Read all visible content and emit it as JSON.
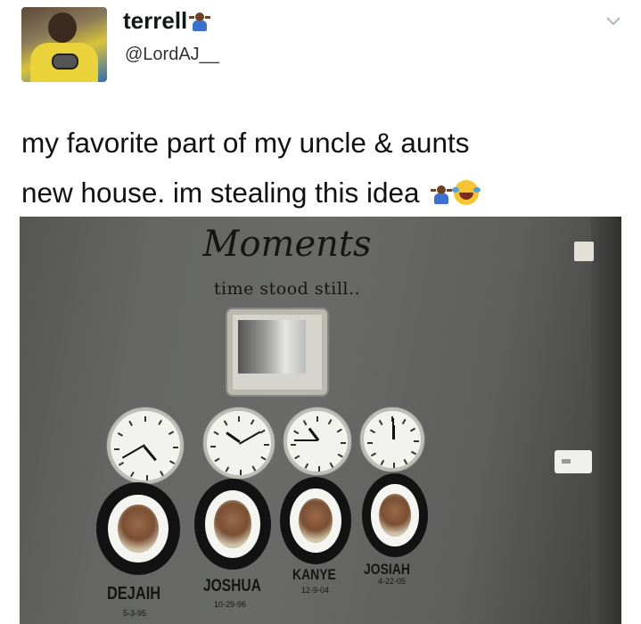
{
  "tweet": {
    "author": {
      "display_name": "terrell",
      "handle": "@LordAJ__",
      "name_emoji": "person-shrugging-emoji"
    },
    "text_line1": "my favorite part of my uncle & aunts",
    "text_line2": "new house. im stealing this idea",
    "trailing_emojis": [
      "person-shrugging-emoji",
      "face-with-tears-of-joy-emoji"
    ],
    "menu_icon": "chevron-down-icon"
  },
  "photo": {
    "wall_title": "Moments",
    "wall_subtitle": "time stood still..",
    "clocks": [
      {
        "time": "4:40"
      },
      {
        "time": "10:10"
      },
      {
        "time": "10:45"
      },
      {
        "time": "12:00"
      }
    ],
    "portraits": [
      {
        "name": "DEJAIH",
        "date": "5-3-95"
      },
      {
        "name": "JOSHUA",
        "date": "10-29-96"
      },
      {
        "name": "KANYE",
        "date": "12-9-04"
      },
      {
        "name": "JOSIAH",
        "date": "4-22-05"
      }
    ]
  },
  "colors": {
    "wall": "#656664",
    "text": "#111111"
  }
}
